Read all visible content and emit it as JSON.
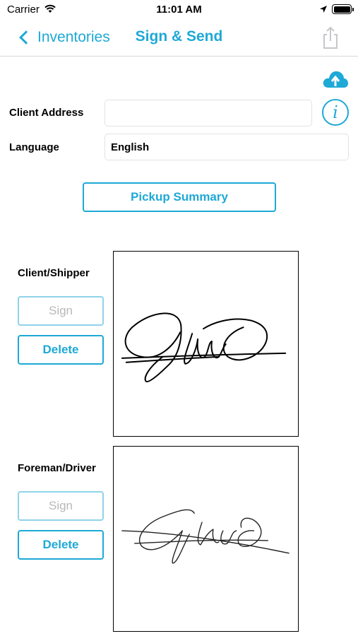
{
  "status_bar": {
    "carrier": "Carrier",
    "time": "11:01 AM",
    "icons": [
      "wifi-icon",
      "location-arrow-icon",
      "battery-icon"
    ]
  },
  "nav": {
    "back_label": "Inventories",
    "title": "Sign & Send",
    "share_icon": "share-icon",
    "accent_color": "#1ea9d6"
  },
  "form": {
    "upload_icon": "cloud-upload-icon",
    "info_icon": "info-icon",
    "client_address": {
      "label": "Client Address",
      "value": ""
    },
    "language": {
      "label": "Language",
      "value": "English"
    },
    "summary_button": "Pickup Summary"
  },
  "signatures": [
    {
      "label": "Client/Shipper",
      "sign_label": "Sign",
      "delete_label": "Delete"
    },
    {
      "label": "Foreman/Driver",
      "sign_label": "Sign",
      "delete_label": "Delete"
    }
  ]
}
